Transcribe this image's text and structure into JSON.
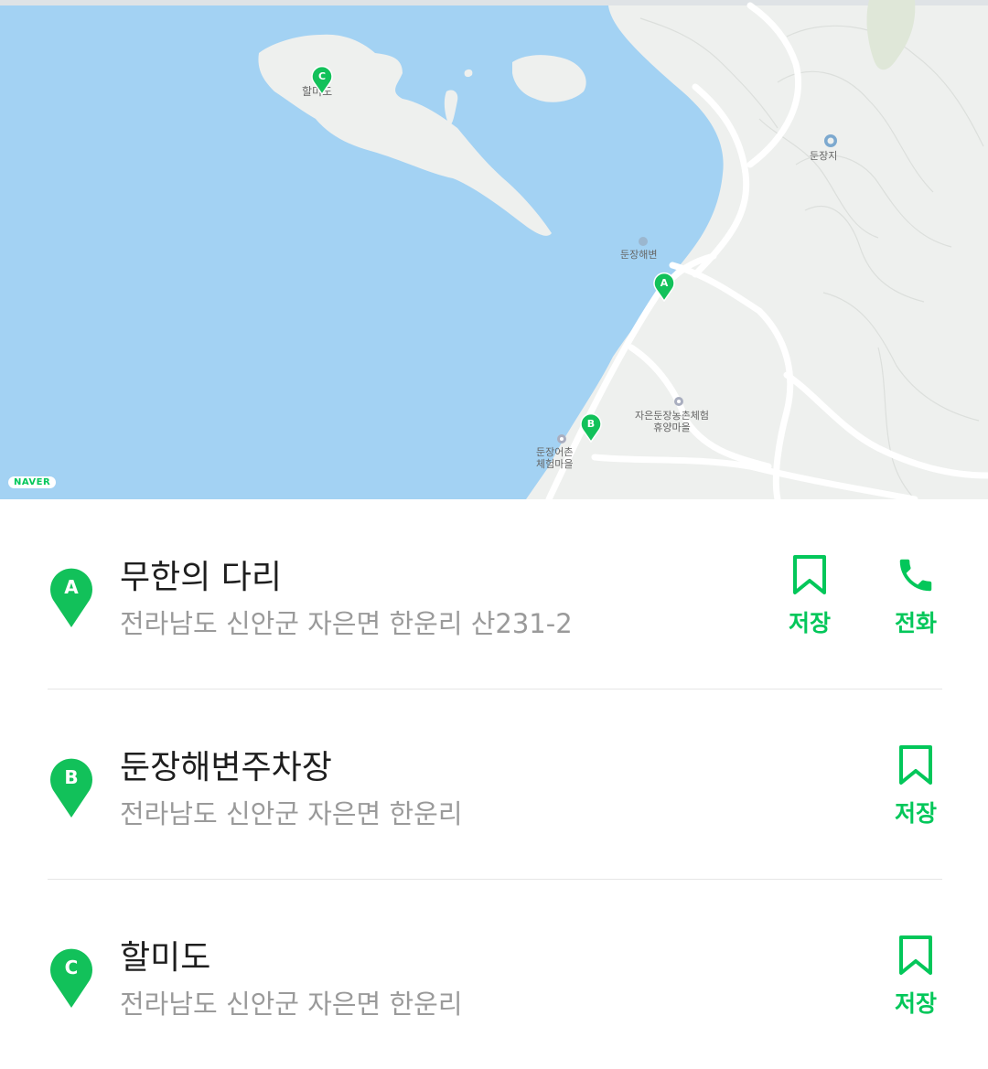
{
  "map": {
    "provider_logo": "NAVER",
    "water_color": "#a3d2f3",
    "land_color": "#eef0ee",
    "labels": {
      "halmido": "할미도",
      "dunjangji": "둔장지",
      "dunjang_beach": "둔장해변",
      "farm_village": "자은둔장농촌체험\n휴양마을",
      "fishing_village": "둔장어촌\n체험마을"
    },
    "markers": [
      "A",
      "B",
      "C"
    ]
  },
  "accent_color": "#03c75a",
  "places": [
    {
      "marker": "A",
      "name": "무한의 다리",
      "address": "전라남도 신안군 자은면 한운리 산231-2",
      "save_label": "저장",
      "call_label": "전화"
    },
    {
      "marker": "B",
      "name": "둔장해변주차장",
      "address": "전라남도 신안군 자은면 한운리",
      "save_label": "저장"
    },
    {
      "marker": "C",
      "name": "할미도",
      "address": "전라남도 신안군 자은면 한운리",
      "save_label": "저장"
    }
  ],
  "icons": {
    "save": "bookmark-icon",
    "call": "phone-icon",
    "marker": "map-pin-icon"
  }
}
